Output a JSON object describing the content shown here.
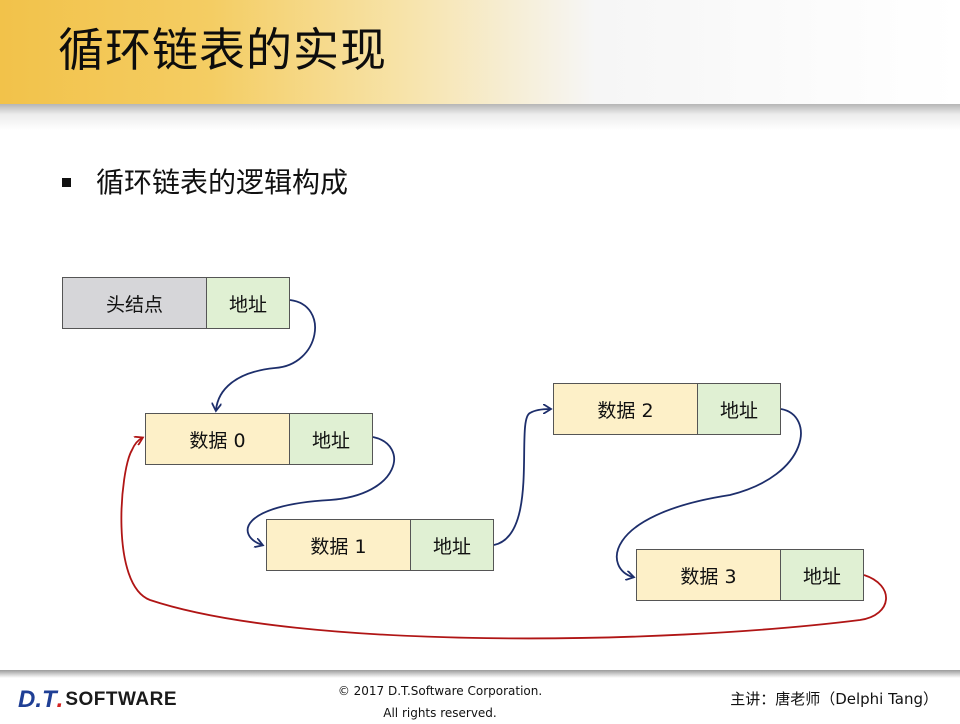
{
  "slide": {
    "title": "循环链表的实现",
    "bullet": "循环链表的逻辑构成"
  },
  "diagram": {
    "head_node": {
      "label": "头结点",
      "addr": "地址"
    },
    "nodes": [
      {
        "label": "数据 0",
        "addr": "地址"
      },
      {
        "label": "数据 1",
        "addr": "地址"
      },
      {
        "label": "数据 2",
        "addr": "地址"
      },
      {
        "label": "数据 3",
        "addr": "地址"
      }
    ],
    "colors": {
      "data_fill": "#fdf0c8",
      "head_fill": "#d6d6d9",
      "addr_fill": "#e0f0d3",
      "link_arrow": "#1d2e6b",
      "loop_arrow": "#b01515"
    }
  },
  "footer": {
    "logo_dt": "D.T",
    "logo_dot": ".",
    "logo_software": "SOFTWARE",
    "copyright_line1": "© 2017 D.T.Software Corporation.",
    "copyright_line2": "All rights reserved.",
    "speaker": "主讲：唐老师（Delphi Tang）"
  }
}
